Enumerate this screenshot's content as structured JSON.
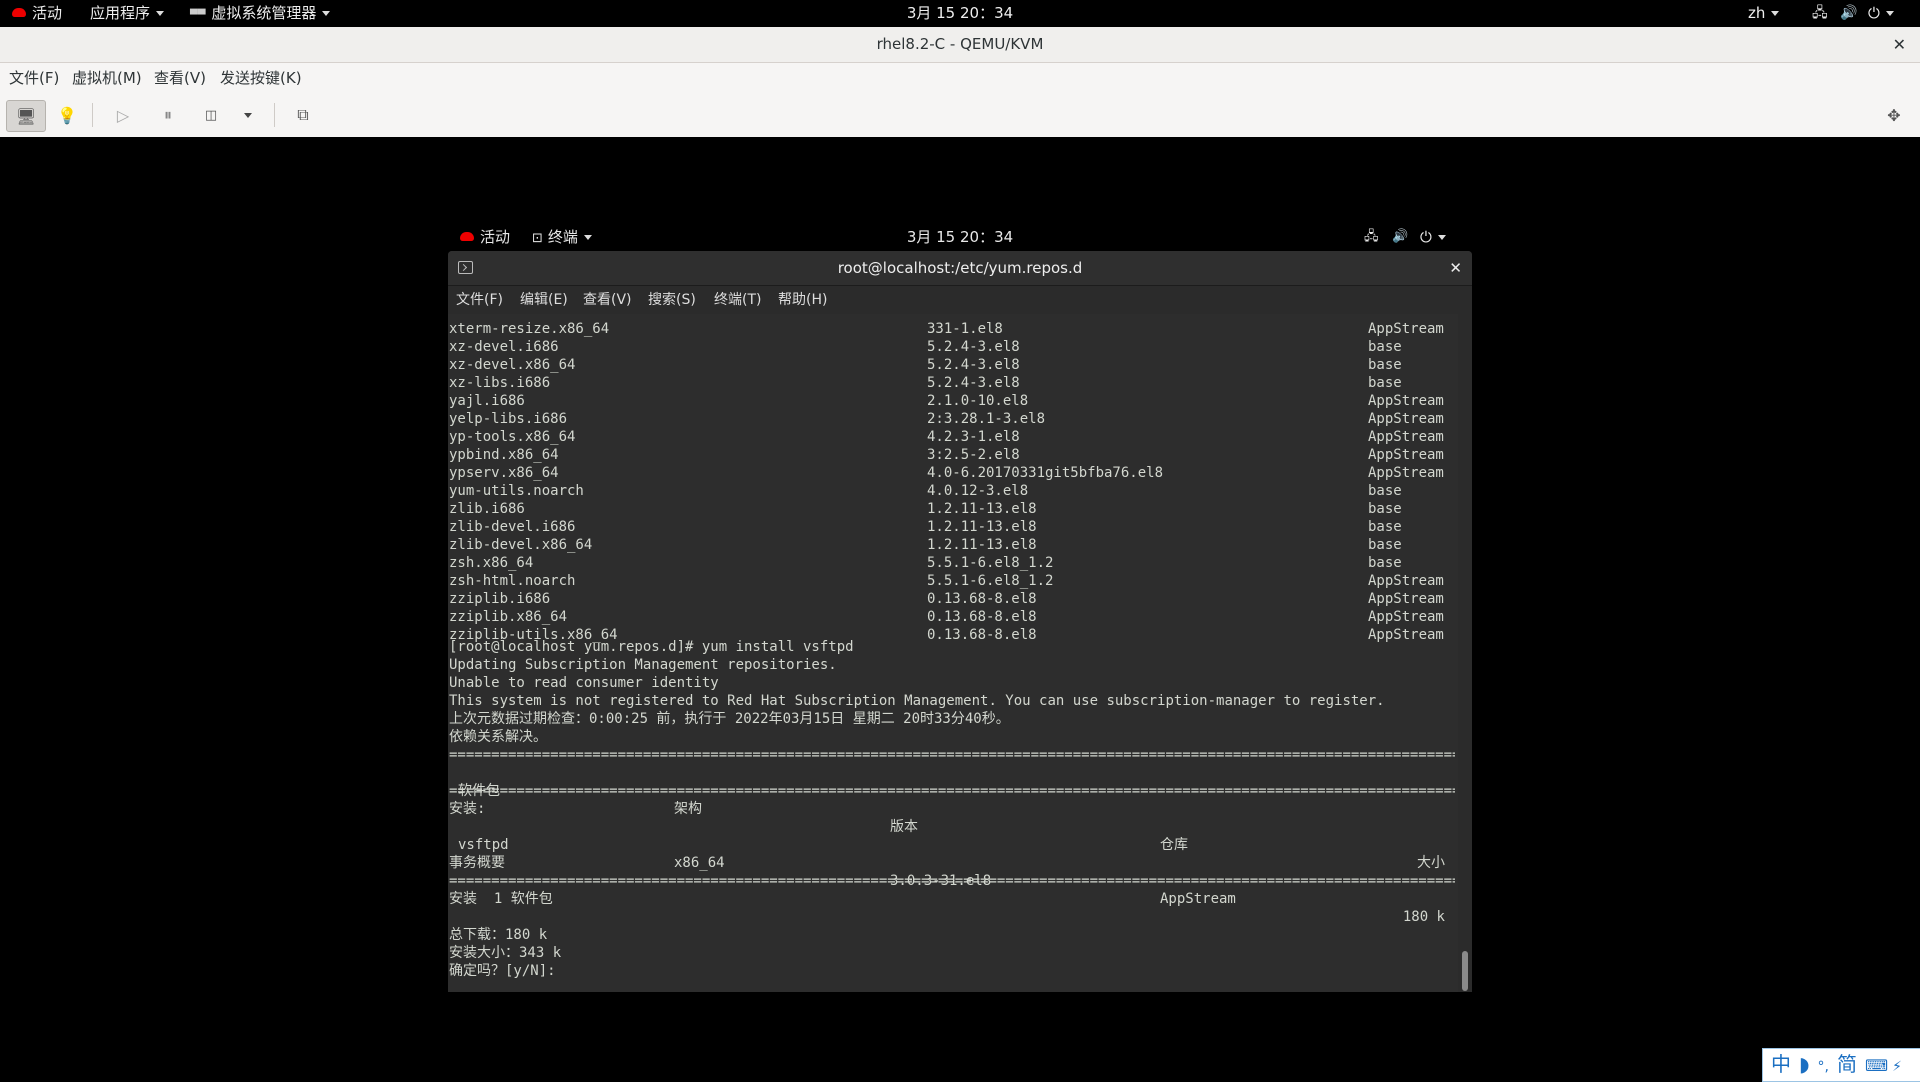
{
  "host_topbar": {
    "activities": "活动",
    "applications": "应用程序",
    "vm_manager": "虚拟系统管理器",
    "clock": "3月 15  20：34",
    "lang": "zh"
  },
  "qemu": {
    "title": "rhel8.2-C - QEMU/KVM",
    "menu": [
      "文件(F)",
      "虚拟机(M)",
      "查看(V)",
      "发送按键(K)"
    ]
  },
  "guest_topbar": {
    "activities": "活动",
    "terminal": "终端",
    "clock": "3月 15  20：34"
  },
  "terminal": {
    "title": "root@localhost:/etc/yum.repos.d",
    "menu": [
      "文件(F)",
      "编辑(E)",
      "查看(V)",
      "搜索(S)",
      "终端(T)",
      "帮助(H)"
    ],
    "package_rows": [
      [
        "xterm-resize.x86_64",
        "331-1.el8",
        "AppStream"
      ],
      [
        "xz-devel.i686",
        "5.2.4-3.el8",
        "base"
      ],
      [
        "xz-devel.x86_64",
        "5.2.4-3.el8",
        "base"
      ],
      [
        "xz-libs.i686",
        "5.2.4-3.el8",
        "base"
      ],
      [
        "yajl.i686",
        "2.1.0-10.el8",
        "AppStream"
      ],
      [
        "yelp-libs.i686",
        "2:3.28.1-3.el8",
        "AppStream"
      ],
      [
        "yp-tools.x86_64",
        "4.2.3-1.el8",
        "AppStream"
      ],
      [
        "ypbind.x86_64",
        "3:2.5-2.el8",
        "AppStream"
      ],
      [
        "ypserv.x86_64",
        "4.0-6.20170331git5bfba76.el8",
        "AppStream"
      ],
      [
        "yum-utils.noarch",
        "4.0.12-3.el8",
        "base"
      ],
      [
        "zlib.i686",
        "1.2.11-13.el8",
        "base"
      ],
      [
        "zlib-devel.i686",
        "1.2.11-13.el8",
        "base"
      ],
      [
        "zlib-devel.x86_64",
        "1.2.11-13.el8",
        "base"
      ],
      [
        "zsh.x86_64",
        "5.5.1-6.el8_1.2",
        "base"
      ],
      [
        "zsh-html.noarch",
        "5.5.1-6.el8_1.2",
        "AppStream"
      ],
      [
        "zziplib.i686",
        "0.13.68-8.el8",
        "AppStream"
      ],
      [
        "zziplib.x86_64",
        "0.13.68-8.el8",
        "AppStream"
      ],
      [
        "zziplib-utils.x86_64",
        "0.13.68-8.el8",
        "AppStream"
      ]
    ],
    "prompt_cmd": "[root@localhost yum.repos.d]# yum install vsftpd",
    "msg1": "Updating Subscription Management repositories.",
    "msg2": "Unable to read consumer identity",
    "msg3": "This system is not registered to Red Hat Subscription Management. You can use subscription-manager to register.",
    "msg4": "上次元数据过期检查：0:00:25 前，执行于 2022年03月15日 星期二 20时33分40秒。",
    "msg5": "依赖关系解决。",
    "header": {
      "pkg": "软件包",
      "arch": "架构",
      "ver": "版本",
      "repo": "仓库",
      "size": "大小"
    },
    "install_label": "安装:",
    "install_row": {
      "pkg": "vsftpd",
      "arch": "x86_64",
      "ver": "3.0.3-31.el8",
      "repo": "AppStream",
      "size": "180 k"
    },
    "summary_label": "事务概要",
    "summary_install": "安装  1 软件包",
    "total_download": "总下载：180 k",
    "install_size": "安装大小：343 k",
    "confirm": "确定吗？[y/N]:"
  },
  "ime": {
    "mode": "中",
    "moon": "◗",
    "punct": "°,",
    "script": "简",
    "keyboard": "⌨",
    "bolt": "⚡"
  }
}
